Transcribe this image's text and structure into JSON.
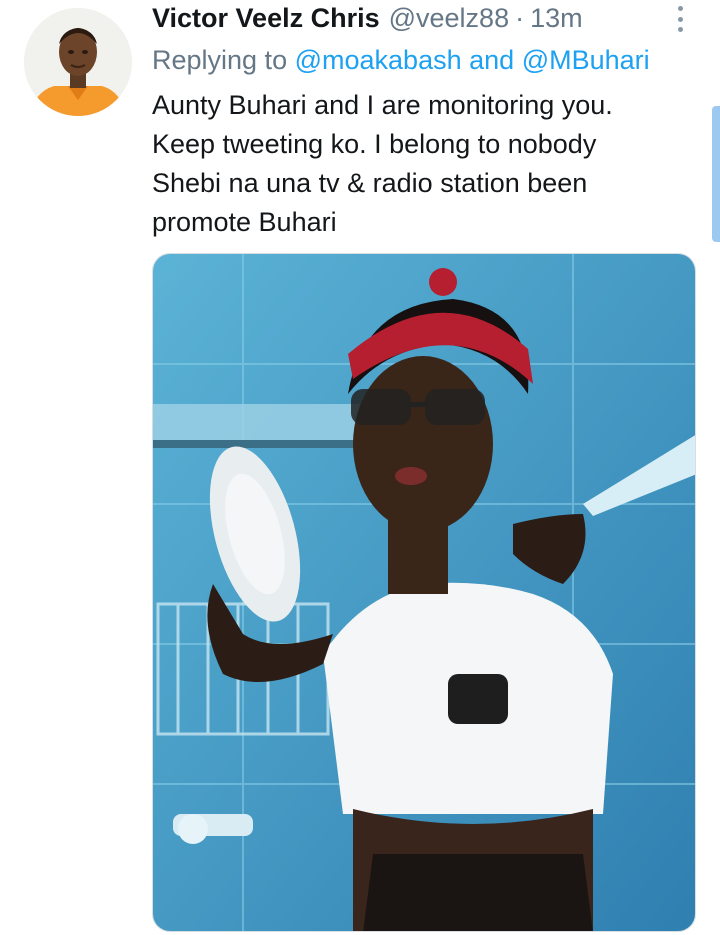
{
  "tweet": {
    "author_name": "Victor Veelz Chris",
    "author_handle": "@veelz88",
    "separator": "·",
    "timestamp": "13m",
    "reply_prefix": "Replying to",
    "reply_mention_1": "@moakabash",
    "reply_and": "and",
    "reply_mention_2": "@MBuhari",
    "text_lines": [
      "Aunty Buhari and I are monitoring you.",
      "Keep tweeting ko. I belong to nobody",
      "Shebi na una tv & radio station been",
      "promote Buhari"
    ]
  },
  "icons": {
    "more": "more-vertical-icon"
  },
  "colors": {
    "text": "#14171a",
    "secondary": "#657786",
    "link": "#1da1f2",
    "background": "#ffffff"
  }
}
